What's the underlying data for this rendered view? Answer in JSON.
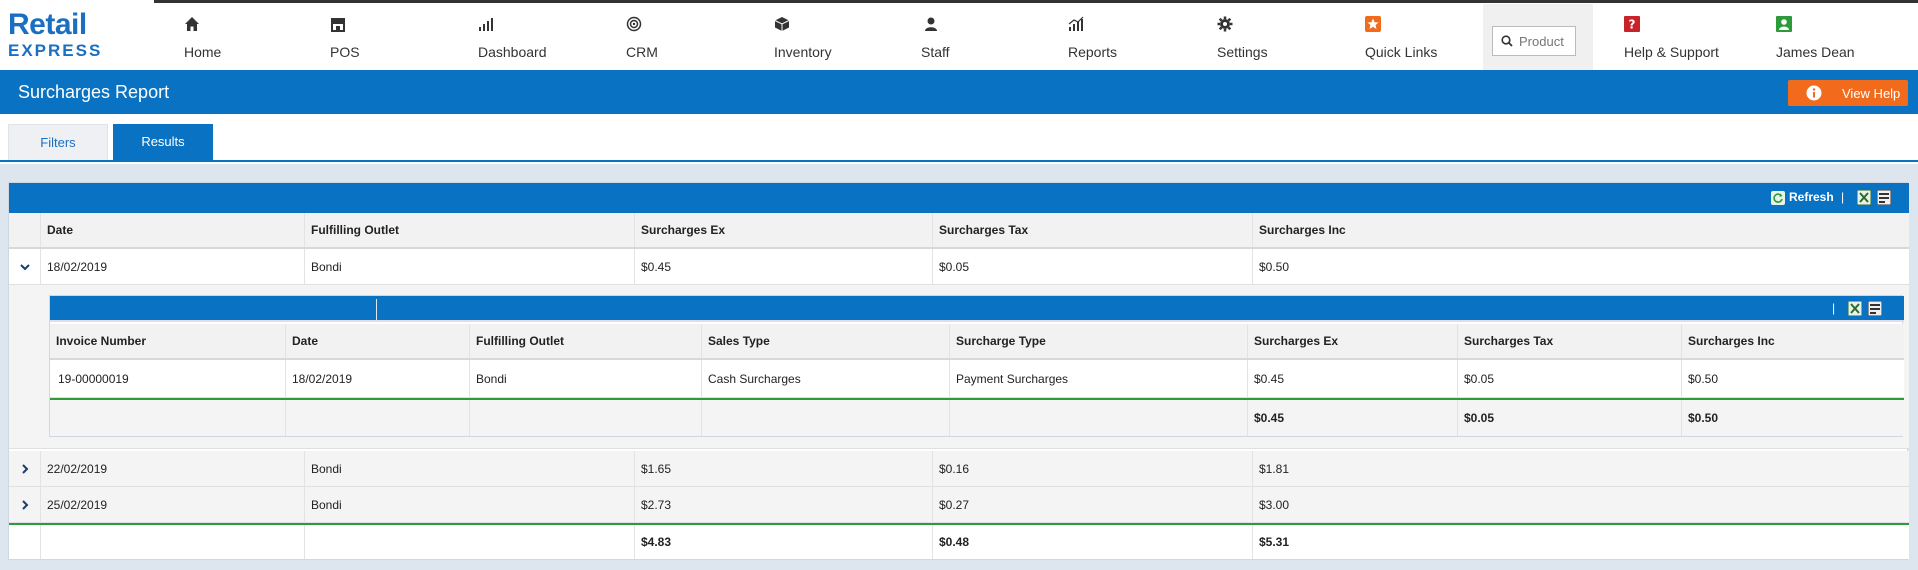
{
  "app": {
    "logo_line1": "Retail",
    "logo_line2": "EXPRESS"
  },
  "nav": {
    "items": [
      {
        "label": "Home",
        "icon": "home-icon"
      },
      {
        "label": "POS",
        "icon": "store-icon"
      },
      {
        "label": "Dashboard",
        "icon": "bar-chart-icon"
      },
      {
        "label": "CRM",
        "icon": "target-icon"
      },
      {
        "label": "Inventory",
        "icon": "box-icon"
      },
      {
        "label": "Staff",
        "icon": "user-icon"
      },
      {
        "label": "Reports",
        "icon": "chart-icon"
      },
      {
        "label": "Settings",
        "icon": "gear-icon"
      },
      {
        "label": "Quick Links",
        "icon": "star-icon"
      },
      {
        "label": "Help & Support",
        "icon": "question-icon"
      },
      {
        "label": "James Dean",
        "icon": "user-badge-icon"
      }
    ],
    "search_placeholder": "Product"
  },
  "header": {
    "title": "Surcharges Report",
    "help_label": "View Help"
  },
  "tabs": [
    {
      "label": "Filters",
      "active": false
    },
    {
      "label": "Results",
      "active": true
    }
  ],
  "toolbar": {
    "refresh_label": "Refresh",
    "separator": "|"
  },
  "grid": {
    "columns": [
      "Date",
      "Fulfilling Outlet",
      "Surcharges Ex",
      "Surcharges Tax",
      "Surcharges Inc"
    ],
    "rows": [
      {
        "date": "18/02/2019",
        "outlet": "Bondi",
        "ex": "$0.45",
        "tax": "$0.05",
        "inc": "$0.50",
        "expanded": true
      },
      {
        "date": "22/02/2019",
        "outlet": "Bondi",
        "ex": "$1.65",
        "tax": "$0.16",
        "inc": "$1.81",
        "expanded": false
      },
      {
        "date": "25/02/2019",
        "outlet": "Bondi",
        "ex": "$2.73",
        "tax": "$0.27",
        "inc": "$3.00",
        "expanded": false
      }
    ],
    "totals": {
      "ex": "$4.83",
      "tax": "$0.48",
      "inc": "$5.31"
    }
  },
  "subgrid": {
    "columns": [
      "Invoice Number",
      "Date",
      "Fulfilling Outlet",
      "Sales Type",
      "Surcharge Type",
      "Surcharges Ex",
      "Surcharges Tax",
      "Surcharges Inc"
    ],
    "rows": [
      {
        "invoice": "19-00000019",
        "date": "18/02/2019",
        "outlet": "Bondi",
        "sales_type": "Cash Surcharges",
        "surcharge_type": "Payment Surcharges",
        "ex": "$0.45",
        "tax": "$0.05",
        "inc": "$0.50"
      }
    ],
    "totals": {
      "ex": "$0.45",
      "tax": "$0.05",
      "inc": "$0.50"
    }
  },
  "colors": {
    "brand_blue": "#0a72c2",
    "accent_orange": "#f26b1d",
    "total_green": "#2e9b3b"
  }
}
